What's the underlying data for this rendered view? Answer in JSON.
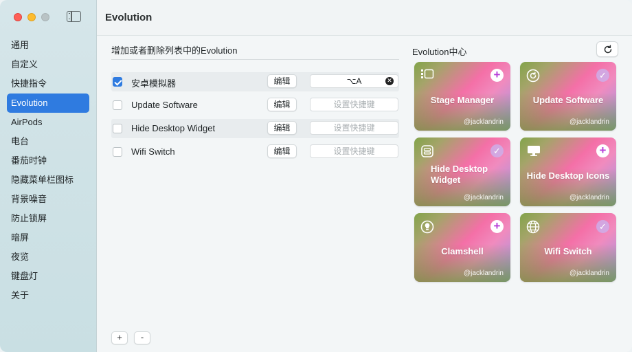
{
  "window": {
    "title": "Evolution"
  },
  "sidebar": {
    "items": [
      {
        "label": "通用",
        "active": false
      },
      {
        "label": "自定义",
        "active": false
      },
      {
        "label": "快捷指令",
        "active": false
      },
      {
        "label": "Evolution",
        "active": true
      },
      {
        "label": "AirPods",
        "active": false
      },
      {
        "label": "电台",
        "active": false
      },
      {
        "label": "番茄时钟",
        "active": false
      },
      {
        "label": "隐藏菜单栏图标",
        "active": false
      },
      {
        "label": "背景噪音",
        "active": false
      },
      {
        "label": "防止锁屏",
        "active": false
      },
      {
        "label": "暗屏",
        "active": false
      },
      {
        "label": "夜览",
        "active": false
      },
      {
        "label": "键盘灯",
        "active": false
      },
      {
        "label": "关于",
        "active": false
      }
    ]
  },
  "list": {
    "title": "增加或者删除列表中的Evolution",
    "edit_label": "编辑",
    "rows": [
      {
        "label": "安卓模拟器",
        "checked": true,
        "shortcut": "⌥A",
        "has_shortcut": true
      },
      {
        "label": "Update Software",
        "checked": false,
        "shortcut": "设置快捷键",
        "has_shortcut": false
      },
      {
        "label": "Hide Desktop Widget",
        "checked": false,
        "shortcut": "设置快捷键",
        "has_shortcut": false
      },
      {
        "label": "Wifi Switch",
        "checked": false,
        "shortcut": "设置快捷键",
        "has_shortcut": false
      }
    ],
    "add_label": "+",
    "remove_label": "-"
  },
  "center": {
    "title": "Evolution中心",
    "cards": [
      {
        "name": "Stage Manager",
        "author": "@jacklandrin",
        "icon": "stage-manager-icon",
        "added": false
      },
      {
        "name": "Update Software",
        "author": "@jacklandrin",
        "icon": "update-icon",
        "added": true
      },
      {
        "name": "Hide Desktop Widget",
        "author": "@jacklandrin",
        "icon": "widget-icon",
        "added": true
      },
      {
        "name": "Hide Desktop Icons",
        "author": "@jacklandrin",
        "icon": "desktop-icon",
        "added": false
      },
      {
        "name": "Clamshell",
        "author": "@jacklandrin",
        "icon": "bulb-icon",
        "added": false
      },
      {
        "name": "Wifi Switch",
        "author": "@jacklandrin",
        "icon": "globe-icon",
        "added": true
      }
    ]
  },
  "colors": {
    "accent": "#2f7be0",
    "close": "#fe5f57",
    "minimize": "#febc2e"
  }
}
